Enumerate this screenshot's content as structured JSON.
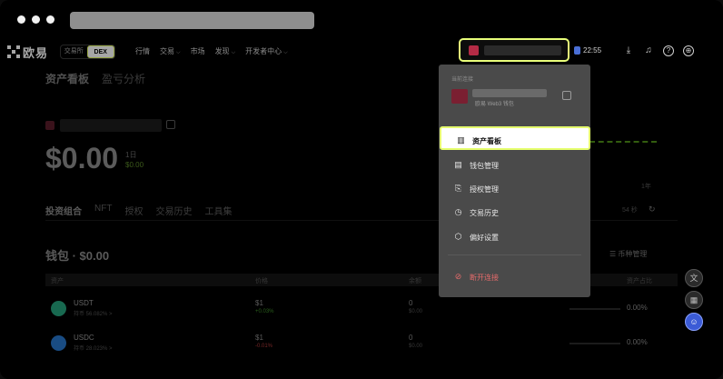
{
  "nav": {
    "logo": "欧易",
    "switch": [
      "交易所",
      "DEX"
    ],
    "links": [
      "行情",
      "交易",
      "市场",
      "发现",
      "开发者中心"
    ],
    "time": "22:55"
  },
  "page": {
    "title_active": "资产看板",
    "title_other": "盈亏分析",
    "balance": "$0.00",
    "period": "1日",
    "change": "$0.00",
    "spark_label_1": "1年",
    "updated": "54 秒",
    "tabs": [
      "投资组合",
      "NFT",
      "授权",
      "交易历史",
      "工具集"
    ],
    "wallet_title": "钱包 · $0.00",
    "coin_manage": "币种管理",
    "table_headers": [
      "资产",
      "价格",
      "余额",
      "资产占比"
    ],
    "rows": [
      {
        "name": "USDT",
        "sub": "持币 56.082% >",
        "price": "$1",
        "change": "+0.03%",
        "balance": "0",
        "balance_usd": "$0.00",
        "pct": "0.00%",
        "color": "#26a17b",
        "change_color": "#3f8f2a"
      },
      {
        "name": "USDC",
        "sub": "持币 28.023% >",
        "price": "$1",
        "change": "-0.01%",
        "balance": "0",
        "balance_usd": "$0.00",
        "pct": "0.00%",
        "color": "#2775ca",
        "change_color": "#b13b3b"
      }
    ]
  },
  "menu": {
    "label": "当前连接",
    "wallet_sub": "欧易 Web3 钱包",
    "items": [
      {
        "label": "资产看板",
        "icon": "dashboard-icon",
        "glyph": "▥"
      },
      {
        "label": "钱包管理",
        "icon": "wallet-icon",
        "glyph": "▤"
      },
      {
        "label": "授权管理",
        "icon": "authorization-icon",
        "glyph": "⎘"
      },
      {
        "label": "交易历史",
        "icon": "history-icon",
        "glyph": "◷"
      },
      {
        "label": "偏好设置",
        "icon": "settings-icon",
        "glyph": "⬡"
      }
    ],
    "disconnect": "断开连接"
  },
  "colors": {
    "accent": "#e6ff6e",
    "danger": "#e46b6b"
  }
}
